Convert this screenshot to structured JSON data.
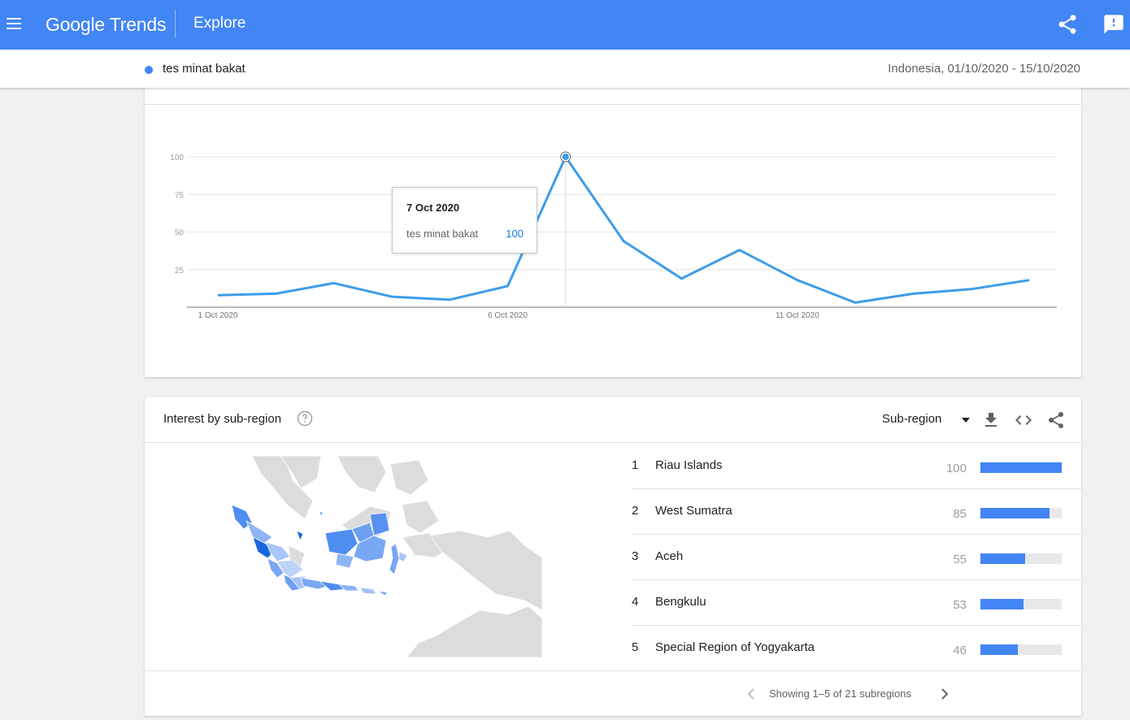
{
  "header": {
    "logo_google": "Google",
    "logo_trends": "Trends",
    "section": "Explore"
  },
  "term_bar": {
    "term": "tes minat bakat",
    "meta": "Indonesia, 01/10/2020 - 15/10/2020"
  },
  "colors": {
    "brand_blue": "#4285f4",
    "line_blue": "#3d9ce8",
    "tooltip_value": "#1a73e8"
  },
  "chart_data": {
    "type": "line",
    "y_ticks": [
      "100",
      "75",
      "50",
      "25"
    ],
    "x_ticks": [
      "1 Oct 2020",
      "6 Oct 2020",
      "11 Oct 2020"
    ],
    "ylim": [
      0,
      100
    ],
    "grid": true,
    "series": [
      {
        "name": "tes minat bakat",
        "x": [
          "2020-10-01",
          "2020-10-02",
          "2020-10-03",
          "2020-10-04",
          "2020-10-05",
          "2020-10-06",
          "2020-10-07",
          "2020-10-08",
          "2020-10-09",
          "2020-10-10",
          "2020-10-11",
          "2020-10-12",
          "2020-10-13",
          "2020-10-14",
          "2020-10-15"
        ],
        "values": [
          8,
          9,
          16,
          7,
          5,
          14,
          100,
          44,
          19,
          38,
          18,
          3,
          9,
          12,
          18
        ]
      }
    ],
    "tooltip": {
      "date": "7 Oct 2020",
      "term": "tes minat bakat",
      "value": "100"
    }
  },
  "region": {
    "title": "Interest by sub-region",
    "selector_label": "Sub-region",
    "rows": [
      {
        "rank": "1",
        "name": "Riau Islands",
        "value": 100
      },
      {
        "rank": "2",
        "name": "West Sumatra",
        "value": 85
      },
      {
        "rank": "3",
        "name": "Aceh",
        "value": 55
      },
      {
        "rank": "4",
        "name": "Bengkulu",
        "value": 53
      },
      {
        "rank": "5",
        "name": "Special Region of Yogyakarta",
        "value": 46
      }
    ],
    "pager_text": "Showing 1–5 of 21 subregions"
  }
}
